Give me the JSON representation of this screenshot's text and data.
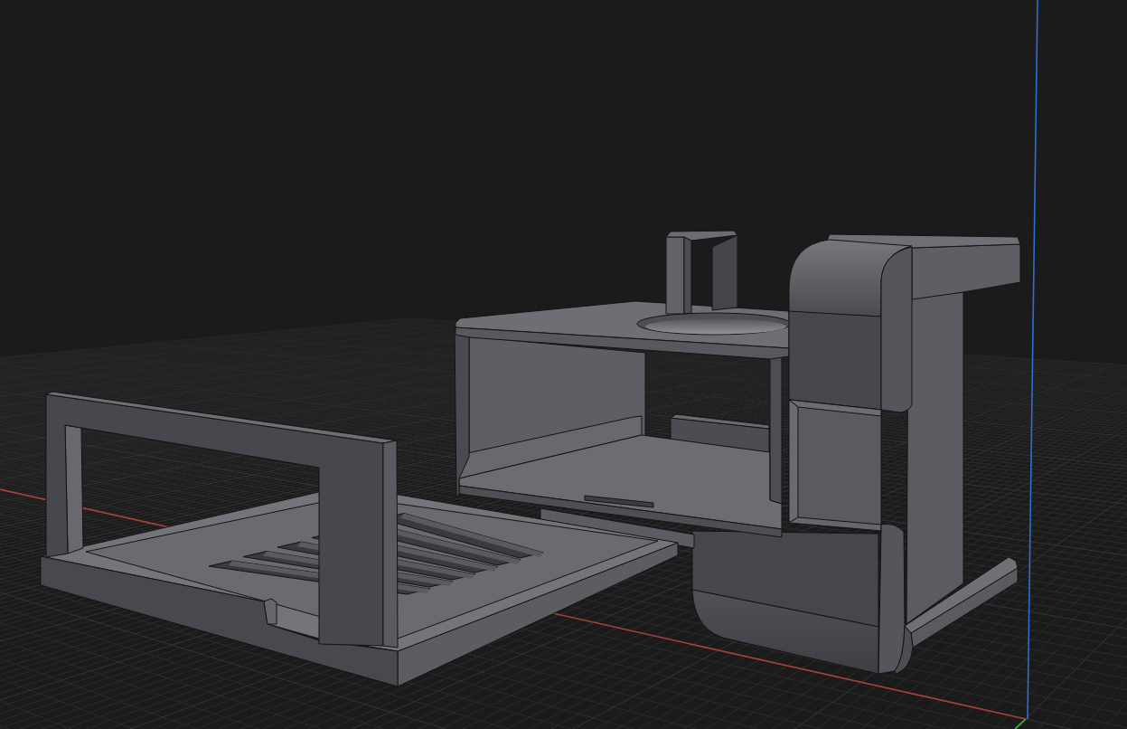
{
  "viewport": {
    "grid": true,
    "axes": [
      {
        "kind": "x",
        "color": "#a8403a"
      },
      {
        "kind": "z",
        "color": "#2b6fd2"
      },
      {
        "kind": "y",
        "color": "#3c9d3c"
      }
    ]
  },
  "models": [
    {
      "kind": "enclosure"
    },
    {
      "kind": "tray"
    }
  ]
}
